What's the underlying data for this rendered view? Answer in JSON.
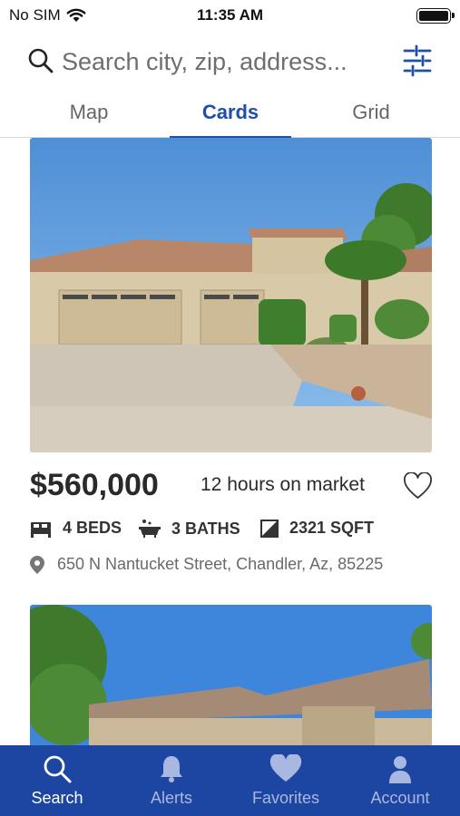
{
  "status_bar": {
    "carrier": "No SIM",
    "time": "11:35 AM"
  },
  "search": {
    "placeholder": "Search city, zip, address..."
  },
  "view_tabs": [
    {
      "label": "Map",
      "active": false
    },
    {
      "label": "Cards",
      "active": true
    },
    {
      "label": "Grid",
      "active": false
    }
  ],
  "listings": [
    {
      "price": "$560,000",
      "time_on_market": "12 hours on market",
      "beds": "4 BEDS",
      "baths": "3 BATHS",
      "sqft": "2321 SQFT",
      "address": "650 N Nantucket Street, Chandler, Az, 85225",
      "favorited": false
    }
  ],
  "bottom_nav": [
    {
      "label": "Search",
      "icon": "search-icon",
      "active": true
    },
    {
      "label": "Alerts",
      "icon": "bell-icon",
      "active": false
    },
    {
      "label": "Favorites",
      "icon": "heart-icon",
      "active": false
    },
    {
      "label": "Account",
      "icon": "person-icon",
      "active": false
    }
  ],
  "colors": {
    "accent": "#1f4fa8",
    "tab_bar": "#1d46a3"
  }
}
